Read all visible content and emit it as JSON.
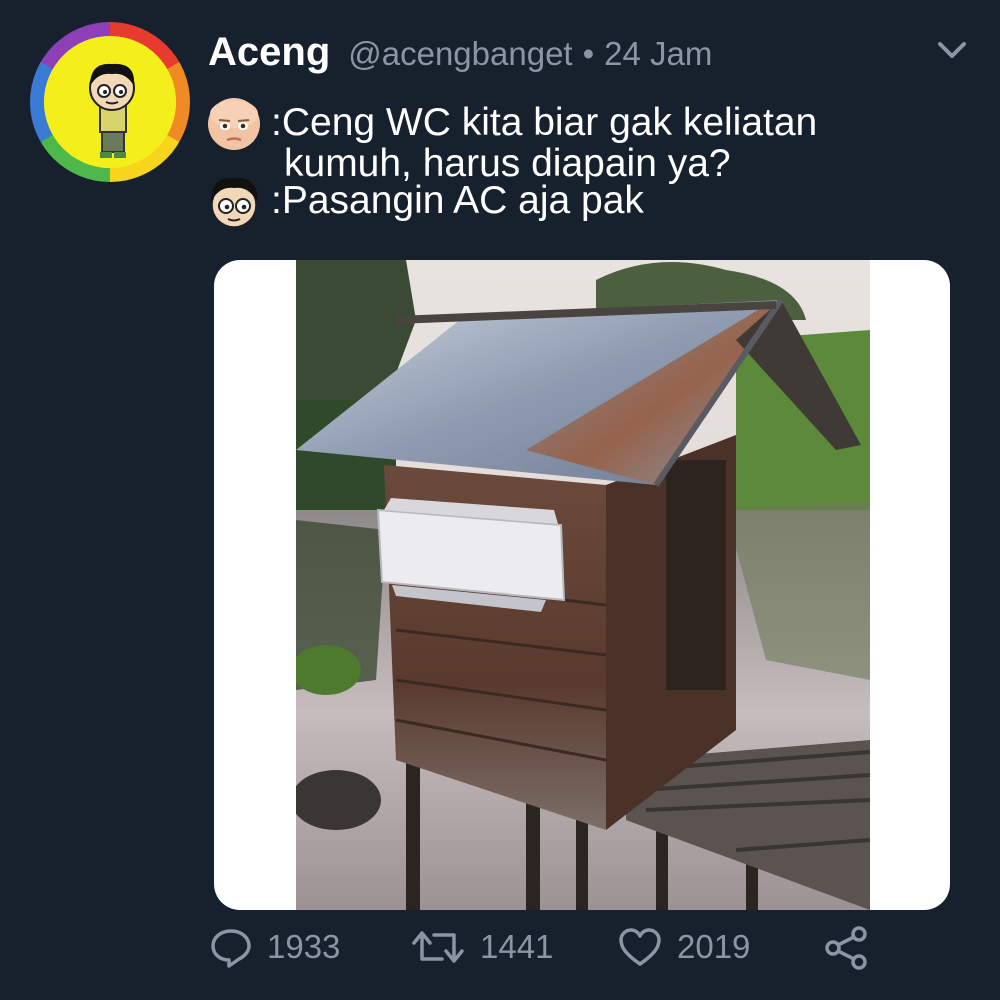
{
  "tweet": {
    "display_name": "Aceng",
    "handle": "@acengbanget",
    "separator": "•",
    "time": "24 Jam",
    "lines": [
      ":Ceng WC kita biar gak keliatan",
      "kumuh, harus diapain ya?",
      ":Pasangin AC aja pak"
    ],
    "icons": {
      "menu": "chevron-down-icon",
      "speaker_1": "baby-boss-face-icon",
      "speaker_2": "aceng-face-icon"
    }
  },
  "stats": {
    "replies": "1933",
    "retweets": "1441",
    "likes": "2019"
  },
  "colors": {
    "background": "#17202d",
    "muted": "#8a96a3",
    "text": "#ffffff"
  }
}
